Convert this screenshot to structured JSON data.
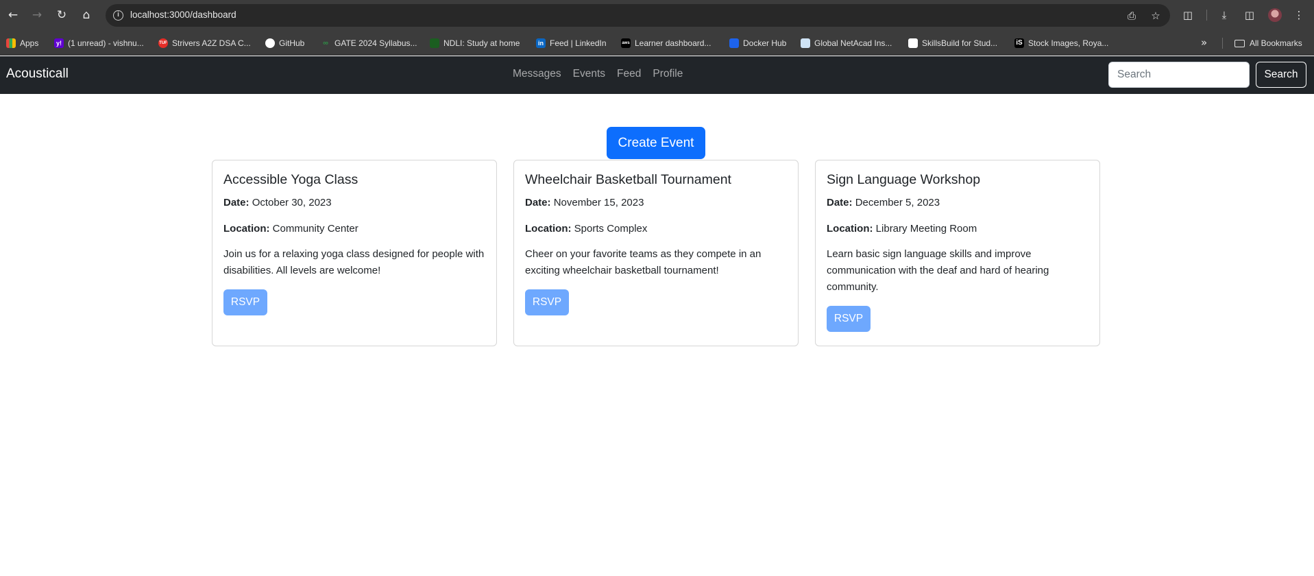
{
  "browser": {
    "url": "localhost:3000/dashboard",
    "icons": {
      "back": "arrow-left-icon",
      "forward": "arrow-right-icon",
      "reload": "reload-icon",
      "home": "home-icon",
      "site_info": "info-icon",
      "install": "install-app-icon",
      "bookmark_star": "star-icon",
      "extensions": "puzzle-icon",
      "downloads": "download-icon",
      "side_panel": "side-panel-icon",
      "menu": "kebab-menu-icon"
    },
    "bookmarks": [
      {
        "label": "Apps",
        "icon": "apps-grid-icon",
        "color": "#e8453c"
      },
      {
        "label": "(1 unread) - vishnu...",
        "icon": "yahoo-icon",
        "color": "#6001d2"
      },
      {
        "label": "Strivers A2Z DSA C...",
        "icon": "tuf-icon",
        "color": "#e52d27"
      },
      {
        "label": "GitHub",
        "icon": "github-icon",
        "color": "#ffffff"
      },
      {
        "label": "GATE 2024 Syllabus...",
        "icon": "gfg-icon",
        "color": "#2f8d46"
      },
      {
        "label": "NDLI: Study at home",
        "icon": "ndli-icon",
        "color": "#1b5e20"
      },
      {
        "label": "Feed | LinkedIn",
        "icon": "linkedin-icon",
        "color": "#0a66c2"
      },
      {
        "label": "Learner dashboard...",
        "icon": "aws-icon",
        "color": "#000000"
      },
      {
        "label": "Docker Hub",
        "icon": "docker-icon",
        "color": "#1d63ed"
      },
      {
        "label": "Global NetAcad Ins...",
        "icon": "netacad-icon",
        "color": "#cfe3f5"
      },
      {
        "label": "SkillsBuild for Stud...",
        "icon": "skillsbuild-icon",
        "color": "#ffffff"
      },
      {
        "label": "Stock Images, Roya...",
        "icon": "istock-icon",
        "color": "#000000"
      }
    ],
    "all_bookmarks": "All Bookmarks"
  },
  "navbar": {
    "brand": "Acousticall",
    "links": [
      "Messages",
      "Events",
      "Feed",
      "Profile"
    ],
    "search_placeholder": "Search",
    "search_button": "Search"
  },
  "main": {
    "create_button": "Create Event",
    "date_label": "Date:",
    "location_label": "Location:",
    "events": [
      {
        "title": "Accessible Yoga Class",
        "date": "October 30, 2023",
        "location": "Community Center",
        "description": "Join us for a relaxing yoga class designed for people with disabilities. All levels are welcome!",
        "rsvp": "RSVP"
      },
      {
        "title": "Wheelchair Basketball Tournament",
        "date": "November 15, 2023",
        "location": "Sports Complex",
        "description": "Cheer on your favorite teams as they compete in an exciting wheelchair basketball tournament!",
        "rsvp": "RSVP"
      },
      {
        "title": "Sign Language Workshop",
        "date": "December 5, 2023",
        "location": "Library Meeting Room",
        "description": "Learn basic sign language skills and improve communication with the deaf and hard of hearing community.",
        "rsvp": "RSVP"
      }
    ]
  },
  "colors": {
    "navbar_bg": "#212529",
    "primary": "#0d6efd",
    "rsvp_bg": "#6ea8fe",
    "chrome_bg": "#3c3c3c"
  }
}
